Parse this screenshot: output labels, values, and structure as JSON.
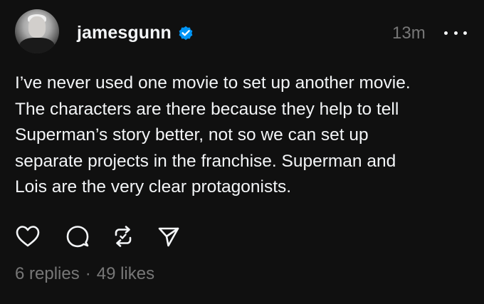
{
  "post": {
    "username": "jamesgunn",
    "time": "13m",
    "text": "I’ve never used one movie to set up another movie.\nThe characters are there because they help to tell\nSuperman’s story better, not so we can set up\nseparate projects in the franchise. Superman and\nLois are the very clear protagonists.",
    "replies": "6 replies",
    "separator": "·",
    "likes": "49 likes"
  },
  "colors": {
    "background": "#101010",
    "text": "#f3f5f7",
    "muted": "#777777",
    "verified": "#0095f6"
  },
  "icons": {
    "verified": "verified-badge-icon",
    "more": "more-icon",
    "like": "heart-icon",
    "reply": "comment-icon",
    "repost": "repost-icon",
    "share": "send-icon"
  }
}
